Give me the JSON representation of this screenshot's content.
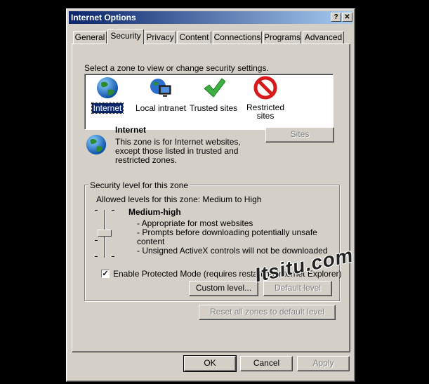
{
  "window": {
    "title": "Internet Options",
    "help_glyph": "?",
    "close_glyph": "✕"
  },
  "tabs": [
    "General",
    "Security",
    "Privacy",
    "Content",
    "Connections",
    "Programs",
    "Advanced"
  ],
  "active_tab": "Security",
  "security": {
    "zone_prompt": "Select a zone to view or change security settings.",
    "zones": [
      {
        "label": "Internet",
        "icon": "globe-icon",
        "selected": true
      },
      {
        "label": "Local intranet",
        "icon": "intranet-icon"
      },
      {
        "label": "Trusted sites",
        "icon": "checkmark-icon"
      },
      {
        "label": "Restricted sites",
        "label_line1": "Restricted",
        "label_line2": "sites",
        "icon": "restricted-icon"
      }
    ],
    "zone_title": "Internet",
    "zone_desc_line1": "This zone is for Internet websites,",
    "zone_desc_line2": "except those listed in trusted and",
    "zone_desc_line3": "restricted zones.",
    "sites_button": "Sites",
    "level_group_title": "Security level for this zone",
    "allowed_levels": "Allowed levels for this zone: Medium to High",
    "level_name": "Medium-high",
    "level_bullets": [
      "- Appropriate for most websites",
      "- Prompts before downloading potentially unsafe",
      "content",
      "- Unsigned ActiveX controls will not be downloaded"
    ],
    "protected_mode_label": "Enable Protected Mode (requires restarting Internet Explorer)",
    "protected_mode_checked": true,
    "custom_level_button": "Custom level...",
    "default_level_button": "Default level",
    "reset_all_button": "Reset all zones to default level"
  },
  "footer": {
    "ok": "OK",
    "cancel": "Cancel",
    "apply": "Apply"
  },
  "watermark": "Itsitu.com",
  "colors": {
    "titlebar_start": "#0a246a",
    "titlebar_end": "#a6caf0",
    "face": "#d4d0c8",
    "selection": "#0a246a"
  }
}
